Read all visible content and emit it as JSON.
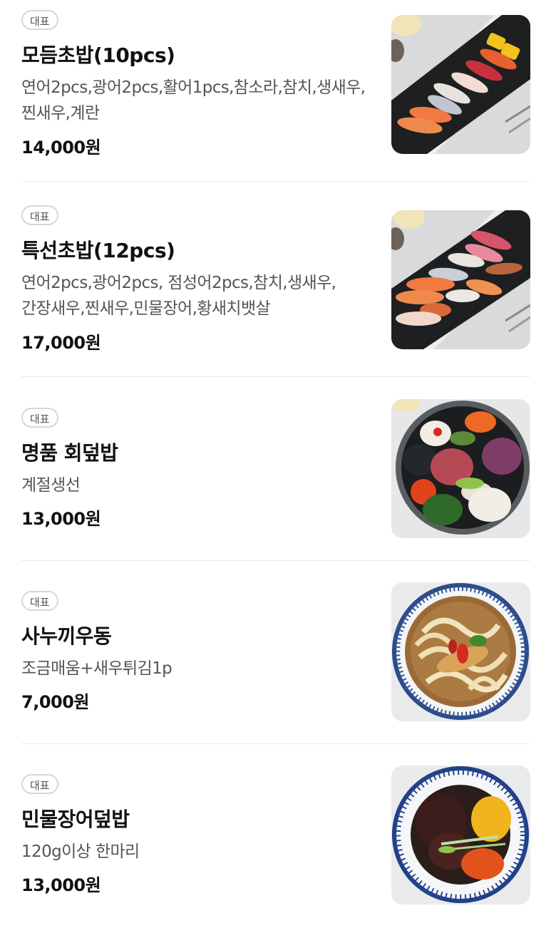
{
  "items": [
    {
      "badge": "대표",
      "name": "모듬초밥(10pcs)",
      "description": "연어2pcs,광어2pcs,활어1pcs,참소라,참치,생새우,찐새우,계란",
      "price": "14,000원",
      "image": "sushi-platter-image"
    },
    {
      "badge": "대표",
      "name": "특선초밥(12pcs)",
      "description": "연어2pcs,광어2pcs, 점성어2pcs,참치,생새우,간장새우,찐새우,민물장어,황새치뱃살",
      "price": "17,000원",
      "image": "premium-sushi-image"
    },
    {
      "badge": "대표",
      "name": "명품 회덮밥",
      "description": "계절생선",
      "price": "13,000원",
      "image": "sashimi-rice-bowl-image"
    },
    {
      "badge": "대표",
      "name": "사누끼우동",
      "description": "조금매움+새우튀김1p",
      "price": "7,000원",
      "image": "udon-bowl-image"
    },
    {
      "badge": "대표",
      "name": "민물장어덮밥",
      "description": "120g이상 한마리",
      "price": "13,000원",
      "image": "eel-rice-bowl-image"
    }
  ]
}
